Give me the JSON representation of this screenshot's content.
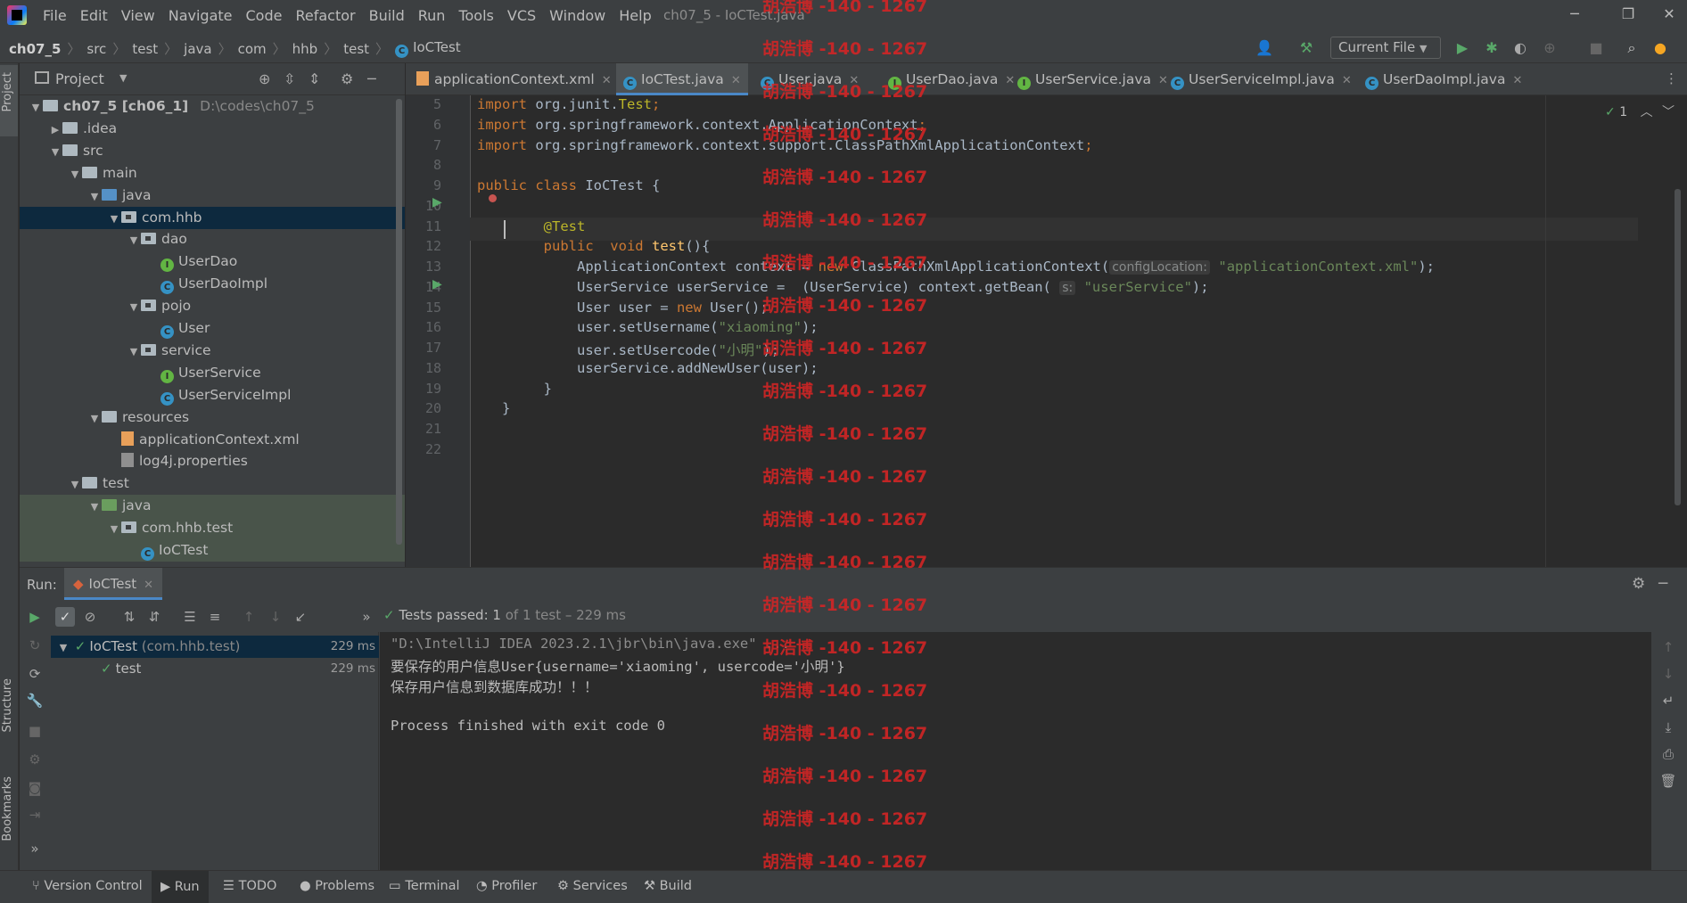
{
  "menu": [
    "File",
    "Edit",
    "View",
    "Navigate",
    "Code",
    "Refactor",
    "Build",
    "Run",
    "Tools",
    "VCS",
    "Window",
    "Help"
  ],
  "window_title": "ch07_5 - IoCTest.java",
  "breadcrumbs": [
    "ch07_5",
    "src",
    "test",
    "java",
    "com",
    "hhb",
    "test",
    "IoCTest"
  ],
  "run_config": "Current File",
  "project_panel": {
    "title": "Project",
    "tree": [
      {
        "label": "ch07_5 [ch06_1]",
        "extra": "D:\\codes\\ch07_5",
        "depth": 0,
        "icon": "folder-icon",
        "arrow": "open"
      },
      {
        "label": ".idea",
        "depth": 1,
        "icon": "folder-icon",
        "arrow": "closed"
      },
      {
        "label": "src",
        "depth": 1,
        "icon": "folder-icon",
        "arrow": "open"
      },
      {
        "label": "main",
        "depth": 2,
        "icon": "folder-icon",
        "arrow": "open"
      },
      {
        "label": "java",
        "depth": 3,
        "icon": "source-folder-icon",
        "arrow": "open"
      },
      {
        "label": "com.hhb",
        "depth": 4,
        "icon": "package-icon",
        "arrow": "open",
        "selected": true
      },
      {
        "label": "dao",
        "depth": 5,
        "icon": "package-icon",
        "arrow": "open"
      },
      {
        "label": "UserDao",
        "depth": 6,
        "icon": "interface-icon"
      },
      {
        "label": "UserDaoImpl",
        "depth": 6,
        "icon": "class-icon"
      },
      {
        "label": "pojo",
        "depth": 5,
        "icon": "package-icon",
        "arrow": "open"
      },
      {
        "label": "User",
        "depth": 6,
        "icon": "class-icon"
      },
      {
        "label": "service",
        "depth": 5,
        "icon": "package-icon",
        "arrow": "open"
      },
      {
        "label": "UserService",
        "depth": 6,
        "icon": "interface-icon"
      },
      {
        "label": "UserServiceImpl",
        "depth": 6,
        "icon": "class-icon"
      },
      {
        "label": "resources",
        "depth": 3,
        "icon": "resources-folder-icon",
        "arrow": "open"
      },
      {
        "label": "applicationContext.xml",
        "depth": 4,
        "icon": "xml-file-icon"
      },
      {
        "label": "log4j.properties",
        "depth": 4,
        "icon": "properties-file-icon"
      },
      {
        "label": "test",
        "depth": 2,
        "icon": "folder-icon",
        "arrow": "open"
      },
      {
        "label": "java",
        "depth": 3,
        "icon": "test-folder-icon",
        "arrow": "open",
        "test": true
      },
      {
        "label": "com.hhb.test",
        "depth": 4,
        "icon": "package-icon",
        "arrow": "open",
        "test": true
      },
      {
        "label": "IoCTest",
        "depth": 5,
        "icon": "class-icon",
        "test": true
      }
    ]
  },
  "editor_tabs": [
    {
      "label": "applicationContext.xml",
      "icon": "xml-file-icon"
    },
    {
      "label": "IoCTest.java",
      "icon": "class-icon",
      "active": true
    },
    {
      "label": "User.java",
      "icon": "class-icon"
    },
    {
      "label": "UserDao.java",
      "icon": "interface-icon"
    },
    {
      "label": "UserService.java",
      "icon": "interface-icon"
    },
    {
      "label": "UserServiceImpl.java",
      "icon": "class-icon"
    },
    {
      "label": "UserDaoImpl.java",
      "icon": "class-icon"
    }
  ],
  "editor": {
    "inspection_count": "1",
    "lines": [
      {
        "n": "5",
        "segs": [
          [
            "kw",
            "import "
          ],
          [
            "",
            "org.junit."
          ],
          [
            "ann",
            "Test"
          ],
          [
            "kw",
            ";"
          ]
        ]
      },
      {
        "n": "6",
        "segs": [
          [
            "kw",
            "import "
          ],
          [
            "",
            "org.springframework.context."
          ],
          [
            "",
            "ApplicationContext"
          ],
          [
            "kw",
            ";"
          ]
        ]
      },
      {
        "n": "7",
        "segs": [
          [
            "kw",
            "import "
          ],
          [
            "",
            "org.springframework.context.support.ClassPathXmlApplicationContext"
          ],
          [
            "kw",
            ";"
          ]
        ]
      },
      {
        "n": "8",
        "segs": []
      },
      {
        "n": "9",
        "segs": [
          [
            "kw",
            "public class "
          ],
          [
            "",
            "IoCTest {"
          ]
        ]
      },
      {
        "n": "10",
        "segs": []
      },
      {
        "n": "11",
        "segs": [
          [
            "",
            "        "
          ],
          [
            "ann",
            "@Test"
          ]
        ]
      },
      {
        "n": "12",
        "segs": [
          [
            "",
            "        "
          ],
          [
            "kw",
            "public  void "
          ],
          [
            "fn",
            "test"
          ],
          [
            "",
            "(){"
          ]
        ]
      },
      {
        "n": "13",
        "segs": [
          [
            "",
            "            ApplicationContext context = "
          ],
          [
            "kw",
            "new "
          ],
          [
            "",
            "ClassPathXmlApplicationContext("
          ],
          [
            "hint",
            "configLocation:"
          ],
          [
            "",
            " "
          ],
          [
            "str",
            "\"applicationContext.xml\""
          ],
          [
            "",
            ");"
          ]
        ]
      },
      {
        "n": "14",
        "segs": [
          [
            "",
            "            UserService userService =  (UserService) context.getBean( "
          ],
          [
            "hint",
            "s:"
          ],
          [
            "",
            " "
          ],
          [
            "str",
            "\"userService\""
          ],
          [
            "",
            ");"
          ]
        ]
      },
      {
        "n": "15",
        "segs": [
          [
            "",
            "            User user = "
          ],
          [
            "kw",
            "new "
          ],
          [
            "",
            "User();"
          ]
        ]
      },
      {
        "n": "16",
        "segs": [
          [
            "",
            "            user.setUsername("
          ],
          [
            "str",
            "\"xiaoming\""
          ],
          [
            "",
            ");"
          ]
        ]
      },
      {
        "n": "17",
        "segs": [
          [
            "",
            "            user.setUsercode("
          ],
          [
            "str",
            "\"小明\""
          ],
          [
            "",
            ");"
          ]
        ]
      },
      {
        "n": "18",
        "segs": [
          [
            "",
            "            userService.addNewUser(user);"
          ]
        ]
      },
      {
        "n": "19",
        "segs": [
          [
            "",
            "        }"
          ]
        ]
      },
      {
        "n": "20",
        "segs": [
          [
            "",
            "   }"
          ]
        ]
      },
      {
        "n": "21",
        "segs": []
      },
      {
        "n": "22",
        "segs": []
      }
    ]
  },
  "run_panel": {
    "label": "Run:",
    "tab": "IoCTest",
    "status_prefix": "Tests passed:",
    "status_count": "1",
    "status_suffix": "of 1 test – 229 ms",
    "tests": [
      {
        "name": "IoCTest",
        "pkg": "(com.hhb.test)",
        "time": "229 ms"
      },
      {
        "name": "test",
        "time": "229 ms"
      }
    ],
    "console": [
      "\"D:\\IntelliJ IDEA 2023.2.1\\jbr\\bin\\java.exe\" ...",
      "要保存的用户信息User{username='xiaoming', usercode='小明'}",
      "保存用户信息到数据库成功！！！",
      "",
      "Process finished with exit code 0"
    ]
  },
  "bottom_tabs": [
    "Version Control",
    "Run",
    "TODO",
    "Problems",
    "Terminal",
    "Profiler",
    "Services",
    "Build"
  ],
  "side_tabs": {
    "project": "Project",
    "structure": "Structure",
    "bookmarks": "Bookmarks"
  },
  "watermark": "胡浩博 -140 - 1267",
  "colors": {
    "accent": "#4a88c7",
    "pass": "#59a869",
    "watermark": "#d62424"
  }
}
